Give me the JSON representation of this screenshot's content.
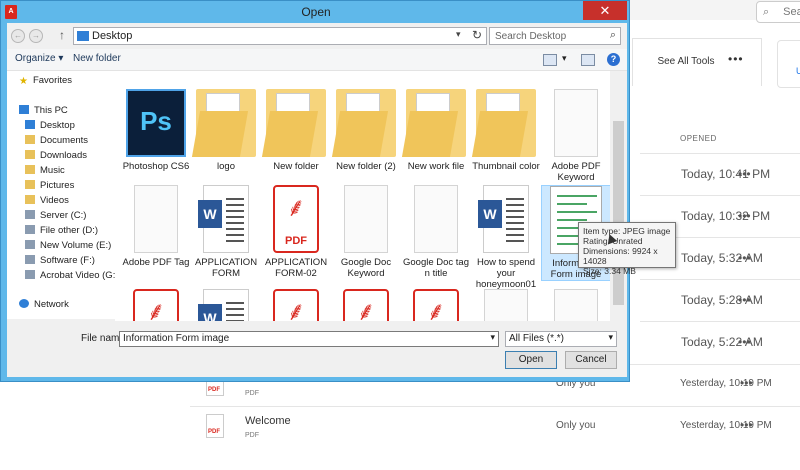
{
  "dialog": {
    "title": "Open",
    "app_icon": "acrobat-icon",
    "close_glyph": "✕"
  },
  "toolbar": {
    "back_glyph": "←",
    "forward_glyph": "→",
    "up_glyph": "↑",
    "breadcrumb": "Desktop",
    "search_placeholder": "Search Desktop",
    "organize": "Organize ▾",
    "new_folder": "New folder"
  },
  "nav": {
    "favorites": "Favorites",
    "this_pc": "This PC",
    "items": [
      "Desktop",
      "Documents",
      "Downloads",
      "Music",
      "Pictures",
      "Videos",
      "Server (C:)",
      "File other (D:)",
      "New Volume (E:)",
      "Software (F:)",
      "Acrobat Video (G:)"
    ],
    "network": "Network"
  },
  "files": [
    {
      "name": "Photoshop CS6",
      "kind": "photoshop"
    },
    {
      "name": "logo",
      "kind": "folder"
    },
    {
      "name": "New folder",
      "kind": "folder"
    },
    {
      "name": "New folder (2)",
      "kind": "folder"
    },
    {
      "name": "New work file",
      "kind": "folder"
    },
    {
      "name": "Thumbnail color",
      "kind": "folder"
    },
    {
      "name": "Adobe PDF Keyword",
      "kind": "blank"
    },
    {
      "name": "Adobe PDF Tag",
      "kind": "blank"
    },
    {
      "name": "APPLICATION FORM",
      "kind": "word"
    },
    {
      "name": "APPLICATION FORM-02",
      "kind": "pdf"
    },
    {
      "name": "Google Doc Keyword",
      "kind": "blank"
    },
    {
      "name": "Google Doc tag n title",
      "kind": "blank"
    },
    {
      "name": "How to spend your honeymoon01",
      "kind": "word"
    },
    {
      "name": "Information Form image",
      "kind": "jpeg"
    },
    {
      "name": "",
      "kind": "pdf"
    },
    {
      "name": "",
      "kind": "word"
    },
    {
      "name": "",
      "kind": "pdf"
    },
    {
      "name": "",
      "kind": "pdf"
    },
    {
      "name": "",
      "kind": "pdf"
    },
    {
      "name": "",
      "kind": "blank"
    },
    {
      "name": "",
      "kind": "blank"
    }
  ],
  "pdf_label": "PDF",
  "word_label": "W",
  "ps_label": "Ps",
  "tooltip": {
    "type": "Item type: JPEG image",
    "rating": "Rating: Unrated",
    "dimensions": "Dimensions: 9924 x 14028",
    "size": "Size: 3.34 MB"
  },
  "bottom": {
    "file_name_label": "File name:",
    "file_name_value": "Information Form image",
    "file_type": "All Files (*.*)",
    "open": "Open",
    "cancel": "Cancel"
  },
  "background": {
    "search": "Search",
    "see_all_tools": "See All Tools",
    "more": "•••",
    "card_link": "U",
    "opened_header": "OPENED",
    "rows": [
      {
        "opened": "Today, 10:41 PM"
      },
      {
        "opened": "Today, 10:32 PM"
      },
      {
        "opened": "Today, 5:32 AM"
      },
      {
        "opened": "Today, 5:28 AM"
      },
      {
        "opened": "Today, 5:22 AM"
      }
    ],
    "file_rows": [
      {
        "name": "",
        "type": "PDF",
        "shared": "Only you",
        "opened": "Yesterday, 10:19 PM"
      },
      {
        "name": "Welcome",
        "type": "PDF",
        "shared": "Only you",
        "opened": "Yesterday, 10:19 PM"
      }
    ],
    "row_more": "•••"
  }
}
